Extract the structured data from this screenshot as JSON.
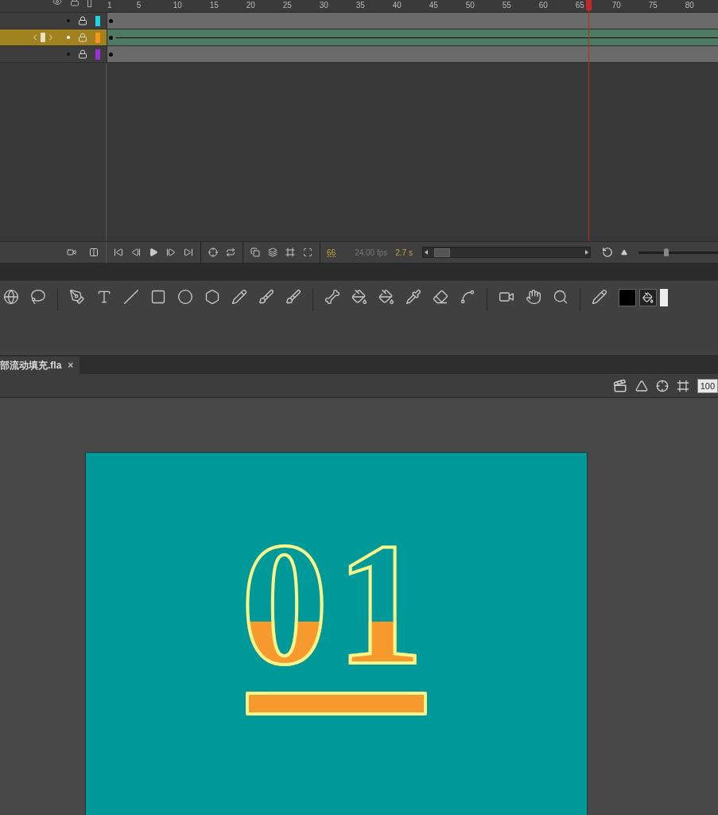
{
  "timeline": {
    "ruler": [
      "1",
      "5",
      "10",
      "15",
      "20",
      "25",
      "30",
      "35",
      "40",
      "45",
      "50",
      "55",
      "60",
      "65",
      "70",
      "75",
      "80"
    ],
    "layers": [
      {
        "color": "#22d3e6",
        "selected": false,
        "tween": false
      },
      {
        "color": "#f7941d",
        "selected": true,
        "tween": true
      },
      {
        "color": "#9b30d9",
        "selected": false,
        "tween": false
      }
    ],
    "current_frame": "66",
    "fps": "24.00 fps",
    "elapsed": "2.7 s"
  },
  "document_tab": {
    "title": "部流动填充.fla",
    "close": "×"
  },
  "zoom": "100",
  "zoom_slider": {
    "level": 0.35
  },
  "stage": {
    "text": "01"
  }
}
